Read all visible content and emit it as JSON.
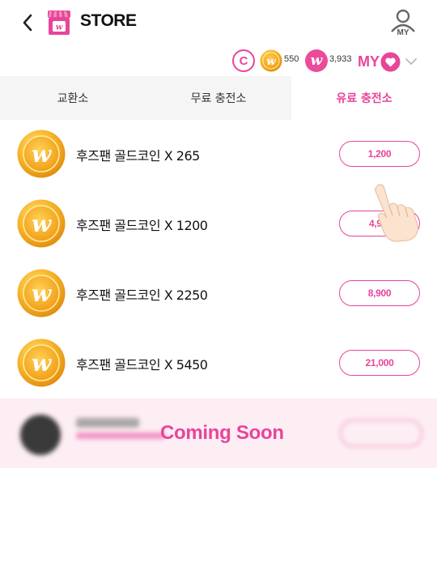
{
  "header": {
    "title": "STORE",
    "my_label": "MY"
  },
  "currency": {
    "gold_coin_amount": "550",
    "w_amount": "3,933",
    "my_love_label": "MY"
  },
  "tabs": [
    {
      "label": "교환소",
      "active": false
    },
    {
      "label": "무료 충전소",
      "active": false
    },
    {
      "label": "유료 충전소",
      "active": true
    }
  ],
  "products": [
    {
      "name": "후즈팬 골드코인 X 265",
      "price": "1,200"
    },
    {
      "name": "후즈팬 골드코인 X 1200",
      "price": "4,9"
    },
    {
      "name": "후즈팬 골드코인 X 2250",
      "price": "8,900"
    },
    {
      "name": "후즈팬 골드코인 X 5450",
      "price": "21,000"
    }
  ],
  "coming_soon": {
    "label": "Coming Soon"
  },
  "colors": {
    "accent": "#e8459a",
    "coin_gold": "#f5a623",
    "tab_bg": "#f5f5f6",
    "coming_soon_bg": "#fdeef4"
  }
}
